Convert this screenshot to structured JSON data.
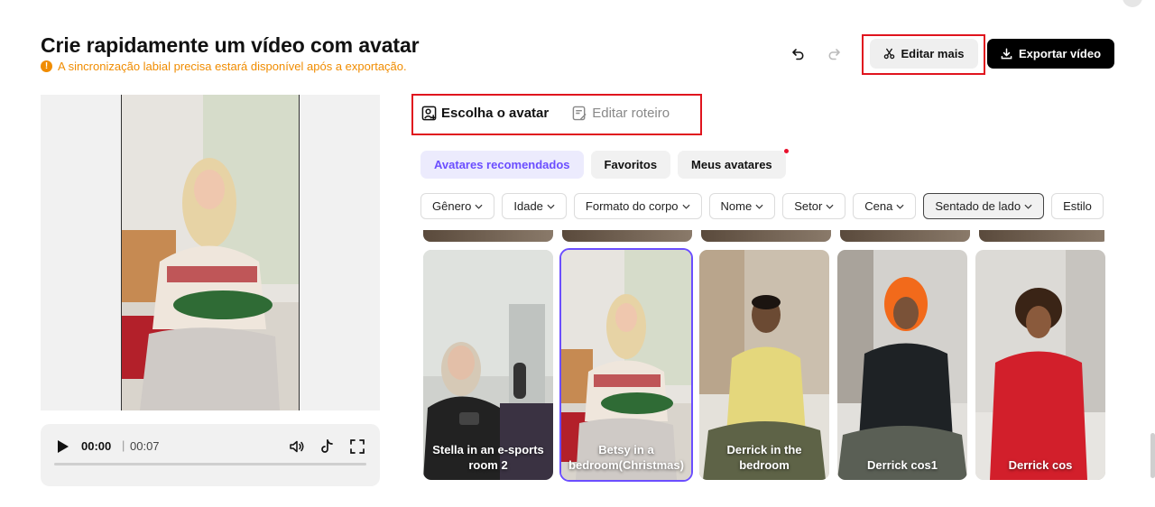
{
  "header": {
    "title": "Crie rapidamente um vídeo com avatar",
    "warning": "A sincronização labial precisa estará disponível após a exportação.",
    "edit_more": "Editar mais",
    "export": "Exportar vídeo"
  },
  "player": {
    "current": "00:00",
    "separator": "|",
    "total": "00:07",
    "progress": 0
  },
  "tabs": [
    {
      "label": "Escolha o avatar",
      "active": true
    },
    {
      "label": "Editar roteiro",
      "active": false
    }
  ],
  "chips": [
    {
      "label": "Avatares recomendados",
      "active": true
    },
    {
      "label": "Favoritos",
      "active": false
    },
    {
      "label": "Meus avatares",
      "active": false
    }
  ],
  "filters": [
    {
      "label": "Gênero"
    },
    {
      "label": "Idade"
    },
    {
      "label": "Formato do corpo"
    },
    {
      "label": "Nome"
    },
    {
      "label": "Setor"
    },
    {
      "label": "Cena"
    },
    {
      "label": "Sentado de lado",
      "selected": true
    },
    {
      "label": "Estilo"
    }
  ],
  "avatars": [
    {
      "label": "Stella in an e-sports room 2"
    },
    {
      "label": "Betsy in a bedroom(Christmas)",
      "selected": true
    },
    {
      "label": "Derrick in the bedroom"
    },
    {
      "label": "Derrick cos1"
    },
    {
      "label": "Derrick cos"
    }
  ],
  "colors": {
    "accent": "#6b4eff",
    "warning": "#f08c00",
    "highlight_box": "#e0141e"
  }
}
